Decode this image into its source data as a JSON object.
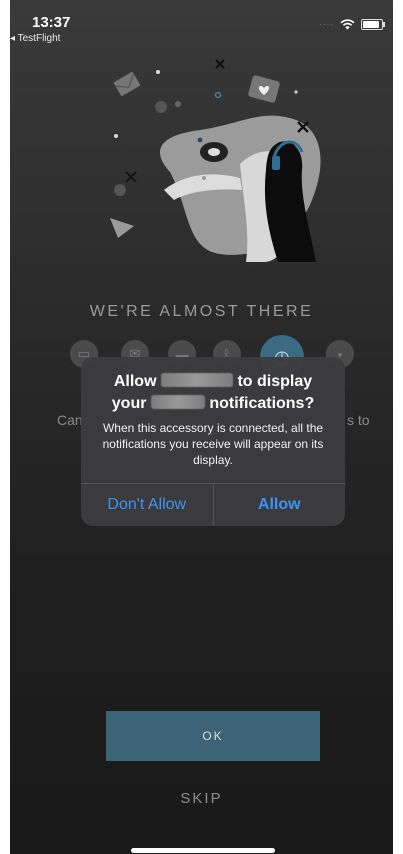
{
  "status_bar": {
    "time": "13:37",
    "back_label": "◂ TestFlight",
    "signal": "····"
  },
  "onboarding": {
    "heading": "WE'RE ALMOST THERE",
    "feature_icons": [
      "display-icon",
      "messages-icon",
      "folder-icon",
      "bluetooth-icon",
      "watch-icon",
      "more-icon"
    ],
    "behind_text_left": "Can",
    "behind_text_right": "s to",
    "ok_label": "OK",
    "skip_label": "SKIP"
  },
  "alert": {
    "title_part1": "Allow",
    "title_part2": "to display",
    "title_part3": "your",
    "title_part4": "notifications?",
    "message": "When this accessory is connected, all the notifications you receive will appear on its display.",
    "deny_label": "Don't Allow",
    "allow_label": "Allow"
  },
  "colors": {
    "accent": "#3d93f5",
    "ok_button": "#3c6476",
    "active_icon": "#3b6b82"
  }
}
